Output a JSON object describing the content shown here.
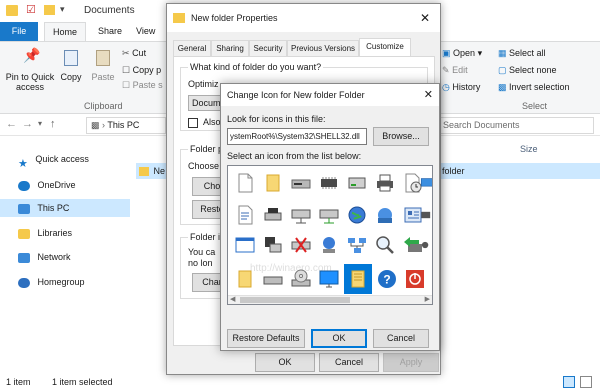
{
  "explorer": {
    "title": "Documents",
    "tabs": [
      {
        "label": "File"
      },
      {
        "label": "Home"
      },
      {
        "label": "Share"
      },
      {
        "label": "View"
      }
    ],
    "ribbon": {
      "pin_label": "Pin to Quick access",
      "copy_label": "Copy",
      "paste_label": "Paste",
      "cut_label": "Cut",
      "copy_path_label": "Copy p",
      "paste_shortcut_label": "Paste s",
      "clipboard_group": "Clipboard",
      "open_label": "Open",
      "edit_label": "Edit",
      "history_label": "History",
      "select_all_label": "Select all",
      "select_none_label": "Select none",
      "invert_selection_label": "Invert selection",
      "select_group": "Select"
    },
    "address": "This PC",
    "search_placeholder": "Search Documents",
    "column_size": "Size",
    "file_item_partial": "Ne",
    "file_item_right": "folder",
    "nav": [
      {
        "label": "Quick access"
      },
      {
        "label": "OneDrive"
      },
      {
        "label": "This PC"
      },
      {
        "label": "Libraries"
      },
      {
        "label": "Network"
      },
      {
        "label": "Homegroup"
      }
    ],
    "status": {
      "count": "1 item",
      "selected": "1 item selected"
    }
  },
  "properties": {
    "title": "New folder Properties",
    "tabs": [
      {
        "label": "General"
      },
      {
        "label": "Sharing"
      },
      {
        "label": "Security"
      },
      {
        "label": "Previous Versions"
      },
      {
        "label": "Customize"
      }
    ],
    "question": "What kind of folder do you want?",
    "optimize_partial": "Optimiz",
    "dropdown_partial": "Docum",
    "also_partial": "Also",
    "folder_pictures_partial": "Folder p",
    "choose_partial": "Choose",
    "choose_btn_partial": "Cho",
    "restore_btn_partial": "Resto",
    "folder_icons_partial": "Folder ic",
    "you_can_partial": "You ca",
    "no_longer_partial": "no lon",
    "change_btn_partial": "Char",
    "ok": "OK",
    "cancel": "Cancel",
    "apply": "Apply"
  },
  "change_icon": {
    "title": "Change Icon for New folder Folder",
    "look_label": "Look for icons in this file:",
    "path_value": "ystemRoot%\\System32\\SHELL32.dll",
    "browse": "Browse...",
    "select_label": "Select an icon from the list below:",
    "restore_defaults": "Restore Defaults",
    "ok": "OK",
    "cancel": "Cancel"
  },
  "colors": {
    "accent": "#1979ca",
    "selection": "#0078d7",
    "nav_selected": "#cce8ff",
    "folder": "#f5c94a"
  },
  "watermark": "http://winaero.com"
}
